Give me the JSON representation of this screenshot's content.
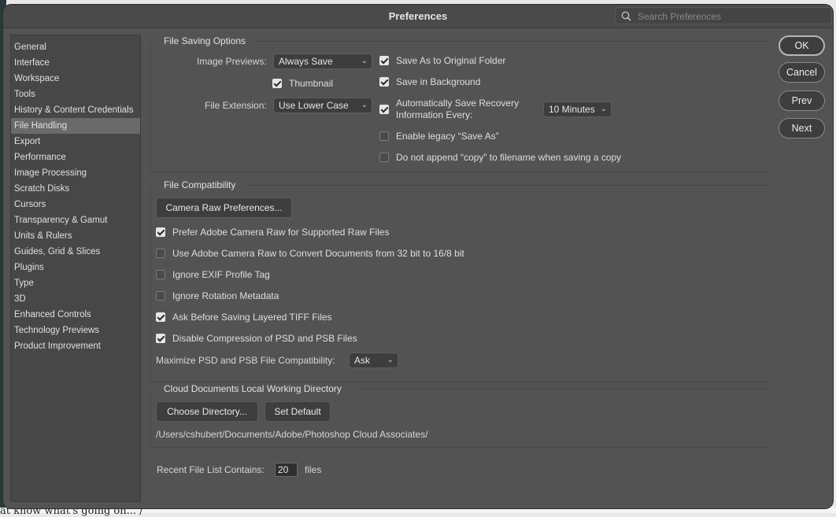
{
  "window": {
    "title": "Preferences"
  },
  "search": {
    "placeholder": "Search Preferences",
    "icon": "search-icon"
  },
  "sidebar": {
    "selected_index": 5,
    "items": [
      {
        "label": "General"
      },
      {
        "label": "Interface"
      },
      {
        "label": "Workspace"
      },
      {
        "label": "Tools"
      },
      {
        "label": "History & Content Credentials"
      },
      {
        "label": "File Handling"
      },
      {
        "label": "Export"
      },
      {
        "label": "Performance"
      },
      {
        "label": "Image Processing"
      },
      {
        "label": "Scratch Disks"
      },
      {
        "label": "Cursors"
      },
      {
        "label": "Transparency & Gamut"
      },
      {
        "label": "Units & Rulers"
      },
      {
        "label": "Guides, Grid & Slices"
      },
      {
        "label": "Plugins"
      },
      {
        "label": "Type"
      },
      {
        "label": "3D"
      },
      {
        "label": "Enhanced Controls"
      },
      {
        "label": "Technology Previews"
      },
      {
        "label": "Product Improvement"
      }
    ]
  },
  "file_saving": {
    "title": "File Saving Options",
    "image_previews_label": "Image Previews:",
    "image_previews_value": "Always Save",
    "thumbnail_label": "Thumbnail",
    "thumbnail_checked": true,
    "file_extension_label": "File Extension:",
    "file_extension_value": "Use Lower Case",
    "save_as_original_label": "Save As to Original Folder",
    "save_as_original_checked": true,
    "save_background_label": "Save in Background",
    "save_background_checked": true,
    "auto_save_label_line1": "Automatically Save Recovery",
    "auto_save_label_line2": "Information Every:",
    "auto_save_checked": true,
    "auto_save_interval": "10 Minutes",
    "legacy_save_as_label": "Enable legacy “Save As”",
    "legacy_save_as_checked": false,
    "no_copy_label": "Do not append “copy” to filename when saving a copy",
    "no_copy_checked": false
  },
  "file_compat": {
    "title": "File Compatibility",
    "camera_raw_button": "Camera Raw Preferences...",
    "options": [
      {
        "label": "Prefer Adobe Camera Raw for Supported Raw Files",
        "checked": true
      },
      {
        "label": "Use Adobe Camera Raw to Convert Documents from 32 bit to 16/8 bit",
        "checked": false
      },
      {
        "label": "Ignore EXIF Profile Tag",
        "checked": false
      },
      {
        "label": "Ignore Rotation Metadata",
        "checked": false
      },
      {
        "label": "Ask Before Saving Layered TIFF Files",
        "checked": true
      },
      {
        "label": "Disable Compression of PSD and PSB Files",
        "checked": true
      }
    ],
    "maximize_label": "Maximize PSD and PSB File Compatibility:",
    "maximize_value": "Ask"
  },
  "cloud_docs": {
    "title": "Cloud Documents Local Working Directory",
    "choose_button": "Choose Directory...",
    "default_button": "Set Default",
    "path": "/Users/cshubert/Documents/Adobe/Photoshop Cloud Associates/"
  },
  "recent": {
    "label": "Recent File List Contains:",
    "value": "20",
    "suffix": "files"
  },
  "actions": {
    "ok": "OK",
    "cancel": "Cancel",
    "prev": "Prev",
    "next": "Next"
  },
  "background_text": "at know what's going on... /"
}
